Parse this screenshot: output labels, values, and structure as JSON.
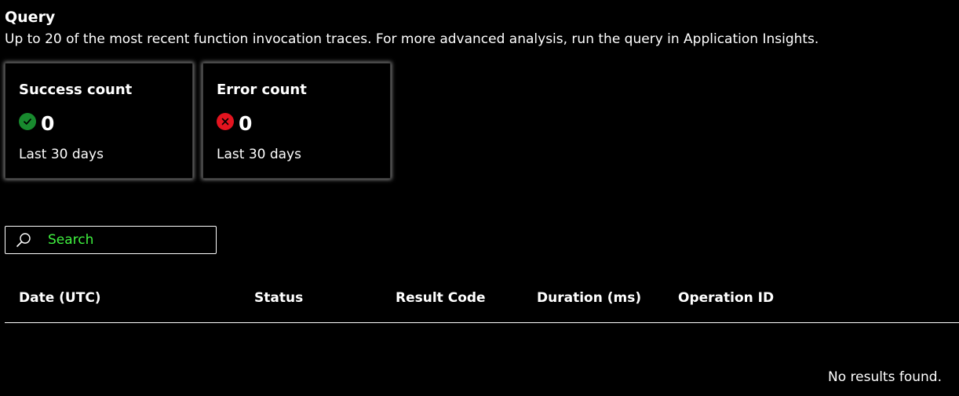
{
  "query_section": {
    "title": "Query",
    "description": "Up to 20 of the most recent function invocation traces. For more advanced analysis, run the query in Application Insights."
  },
  "summary_cards": {
    "success": {
      "title": "Success count",
      "value": "0",
      "period": "Last 30 days",
      "icon": "check-circle-icon",
      "color": "#188a2e"
    },
    "error": {
      "title": "Error count",
      "value": "0",
      "period": "Last 30 days",
      "icon": "error-circle-icon",
      "color": "#e3141f"
    }
  },
  "search": {
    "placeholder": "Search",
    "value": "",
    "icon": "search-icon",
    "placeholder_color": "#3ff23f"
  },
  "table": {
    "columns": [
      "Date (UTC)",
      "Status",
      "Result Code",
      "Duration (ms)",
      "Operation ID"
    ],
    "rows": [],
    "empty_message": "No results found."
  },
  "colors": {
    "background": "#000000",
    "text": "#ffffff"
  }
}
